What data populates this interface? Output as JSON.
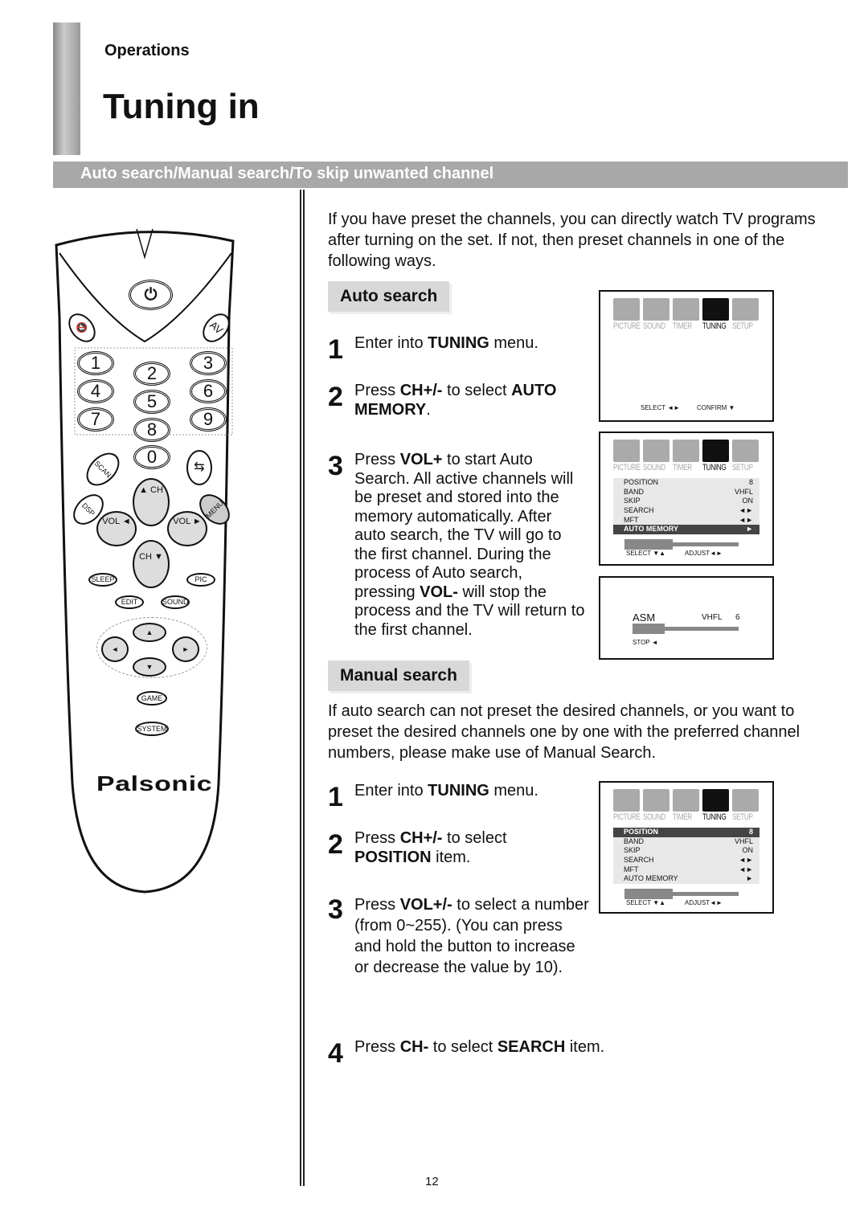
{
  "header": {
    "section": "Operations",
    "title": "Tuning in",
    "banner": "Auto search/Manual search/To skip unwanted channel"
  },
  "intro": "If you have preset the channels, you can directly watch TV programs after turning on the set. If not, then preset channels in one of the following ways.",
  "auto": {
    "heading": "Auto search",
    "s1": {
      "num": "1",
      "pre": "Enter into ",
      "b": "TUNING",
      "post": " menu."
    },
    "s2": {
      "num": "2",
      "pre": "Press ",
      "b": "CH+/-",
      "mid": " to select ",
      "b2": "AUTO MEMORY",
      "post": "."
    },
    "s3": {
      "num": "3",
      "pre": "Press ",
      "b": "VOL+",
      "mid": " to start Auto Search. All active channels will be preset and stored into the memory automatically. After auto search, the TV will go to the first channel. During the process of Auto search, pressing ",
      "b2": "VOL-",
      "post": " will stop the process and the TV will return to the first channel."
    }
  },
  "manual": {
    "heading": "Manual search",
    "intro": "If auto search can not preset the desired channels, or you want to preset the desired channels one by one with the preferred channel numbers, please make use of Manual Search.",
    "s1": {
      "num": "1",
      "pre": "Enter into ",
      "b": "TUNING",
      "post": " menu."
    },
    "s2": {
      "num": "2",
      "pre": "Press ",
      "b": "CH+/-",
      "mid": " to select ",
      "b2": "POSITION",
      "post": " item."
    },
    "s3": {
      "num": "3",
      "pre": "Press ",
      "b": "VOL+/-",
      "post": " to select a number (from 0~255). (You can press and hold the button to increase or decrease the value by 10)."
    },
    "s4": {
      "num": "4",
      "pre": "Press ",
      "b": "CH-",
      "mid": " to select ",
      "b2": "SEARCH",
      "post": " item."
    }
  },
  "menu_tabs": [
    "PICTURE",
    "SOUND",
    "TIMER",
    "TUNING",
    "SETUP"
  ],
  "screens": [
    {
      "hint_left": "SELECT ◄►",
      "hint_right": "CONFIRM ▼"
    },
    {
      "rows": [
        [
          "POSITION",
          "8"
        ],
        [
          "BAND",
          "VHFL"
        ],
        [
          "SKIP",
          "ON"
        ],
        [
          "SEARCH",
          "◄►"
        ],
        [
          "MFT",
          "◄►"
        ],
        [
          "AUTO MEMORY",
          "►"
        ]
      ],
      "highlight": 5,
      "progress": 0.42,
      "hint_left": "SELECT ▼▲",
      "hint_right": "ADJUST◄►"
    },
    {
      "label": "ASM",
      "band": "VHFL",
      "channel": "6",
      "progress": 0.3,
      "hint": "STOP ◄"
    },
    {
      "rows": [
        [
          "POSITION",
          "8"
        ],
        [
          "BAND",
          "VHFL"
        ],
        [
          "SKIP",
          "ON"
        ],
        [
          "SEARCH",
          "◄►"
        ],
        [
          "MFT",
          "◄►"
        ],
        [
          "AUTO MEMORY",
          "►"
        ]
      ],
      "highlight": 0,
      "progress": 0.42,
      "hint_left": "SELECT ▼▲",
      "hint_right": "ADJUST◄►"
    }
  ],
  "remote": {
    "brand": "Palsonic",
    "digits": [
      "1",
      "2",
      "3",
      "4",
      "5",
      "6",
      "7",
      "8",
      "9",
      "0"
    ],
    "av": "AV",
    "scan": "SCAN",
    "dsp": "DSP",
    "menu": "MENU",
    "vol": "VOL",
    "ch": "CH",
    "sleep": "SLEEP",
    "pic": "PIC",
    "edit": "EDIT",
    "sound": "SOUND",
    "game": "GAME",
    "system": "SYSTEM"
  },
  "page_number": "12"
}
